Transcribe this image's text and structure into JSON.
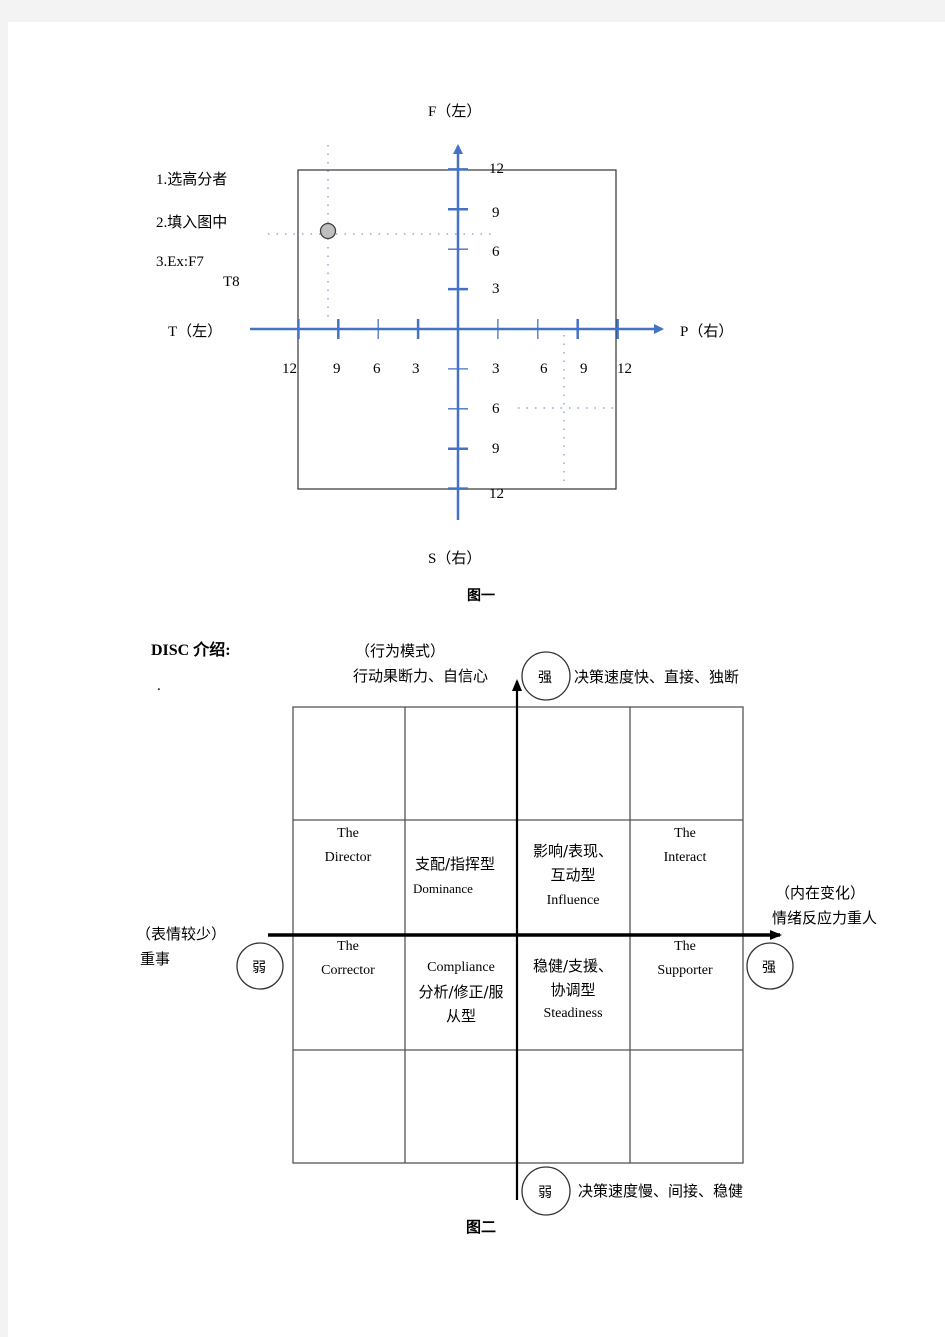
{
  "figure1": {
    "caption": "图一",
    "axes": {
      "top_label": "F（左）",
      "bottom_label": "S（右）",
      "left_label": "T（左）",
      "right_label": "P（右）"
    },
    "instructions": [
      "1.选高分者",
      "2.填入图中",
      "3.Ex:F7",
      "T8"
    ],
    "tick_labels": {
      "up": [
        "12",
        "9",
        "6",
        "3"
      ],
      "down": [
        "3",
        "6",
        "9",
        "12"
      ],
      "left": [
        "12",
        "9",
        "6",
        "3"
      ],
      "right": [
        "3",
        "6",
        "9",
        "12"
      ]
    },
    "example_point": {
      "F": 7,
      "T": 8
    },
    "second_guide": {
      "S": 6,
      "P": 7.5
    },
    "axis_color": "#4472c4",
    "point_color": "#bfbfbf"
  },
  "figure2": {
    "title": "DISC 介绍:",
    "dot": ".",
    "caption": "图二",
    "top_axis": {
      "label_line1": "（行为模式）",
      "label_line2": "行动果断力、自信心",
      "strong_badge": "强",
      "strong_desc": "决策速度快、直接、独断"
    },
    "bottom_axis": {
      "weak_badge": "弱",
      "weak_desc": "决策速度慢、间接、稳健"
    },
    "left_axis": {
      "label_line1": "（表情较少）",
      "label_line2": "重事",
      "weak_badge": "弱"
    },
    "right_axis": {
      "label_line1": "（内在变化）",
      "label_line2": "情绪反应力重人",
      "strong_badge": "强"
    },
    "cells": {
      "director": {
        "line1": "The",
        "line2": "Director"
      },
      "dominance": {
        "cn": "支配/指挥型",
        "en": "Dominance"
      },
      "influence": {
        "cn1": "影响/表现、",
        "cn2": "互动型",
        "en": "Influence"
      },
      "interact": {
        "line1": "The",
        "line2": "Interact"
      },
      "corrector": {
        "line1": "The",
        "line2": "Corrector"
      },
      "compliance": {
        "en": "Compliance",
        "cn1": "分析/修正/服",
        "cn2": "从型"
      },
      "steadiness": {
        "cn1": "稳健/支援、",
        "cn2": "协调型",
        "en": "Steadiness"
      },
      "supporter": {
        "line1": "The",
        "line2": "Supporter"
      }
    }
  }
}
